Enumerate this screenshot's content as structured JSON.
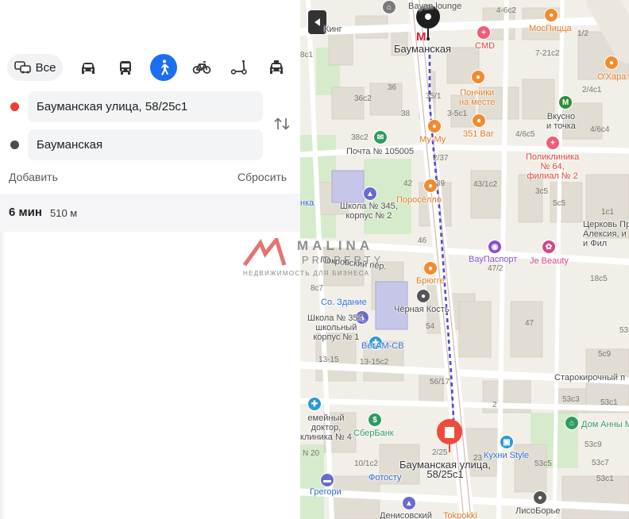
{
  "panel": {
    "modes": {
      "all_label": "Все",
      "items": [
        {
          "icon": "car-icon"
        },
        {
          "icon": "bus-icon"
        },
        {
          "icon": "pedestrian-icon",
          "active": true
        },
        {
          "icon": "bicycle-icon"
        },
        {
          "icon": "scooter-icon"
        },
        {
          "icon": "taxi-icon"
        }
      ]
    },
    "route": {
      "from_value": "Бауманская улица, 58/25с1",
      "to_value": "Бауманская",
      "from_dot_color": "#f33a2e",
      "to_dot_color": "#4d4d4d"
    },
    "add_label": "Добавить",
    "reset_label": "Сбросить",
    "result": {
      "time": "6 мин",
      "distance": "510 м"
    }
  },
  "watermark": {
    "line1": "MALINA",
    "line2": "PROPERTY",
    "line3": "НЕДВИЖИМОСТЬ ДЛЯ БИЗНЕСА"
  },
  "map": {
    "labels": {
      "bayan_lounge": "Bayan lounge",
      "king": "Кинг",
      "cmd": "CMD",
      "mospizza": "МосПицца",
      "station": "Бауманская",
      "okhara": "О'Хара",
      "ponchiki": "Пончики\nна месте",
      "vkusno": "Вкусно\nи точка",
      "bar351": "351 Bar",
      "mumu": "Му-Му",
      "pochta": "Почта № 105005",
      "poliklinika": "Поликлиника\n№ 64,\nфилиал № 2",
      "poroselo": "Поросёлло",
      "school345": "Школа № 345,\nкорпус № 2",
      "tserkov": "Церковь Пр\nАлексия, и\nи Фил",
      "vaupasport": "ВауПаспорт",
      "jebeauty": "Je Beauty",
      "pokrovsky": "Покровский пер.",
      "bryugge": "Брюгге",
      "chernaya": "Чёрная Кость",
      "sozdanie": "Со. Здание",
      "school354": "Школа № 354,\nшкольный\nкорпус № 1",
      "vetam": "ВетАМ-СВ",
      "starokirochny": "Старокирочный п",
      "semeyny": "емейный\nдоктор,\nклиника № 4",
      "sberbank": "СберБанк",
      "dom_anny": "Дом Анны М",
      "kukhni": "Кухни Style",
      "destination": "Бауманская улица,\n58/25с1",
      "fotostudio": "Фотосту",
      "gregori": "Грегори",
      "lisoborye": "ЛисоБорье",
      "denisovsky": "Денисовский",
      "tokpokki": "Tokpokki",
      "linka": "нка"
    },
    "numbers": [
      "4-6c2",
      "7-21c2",
      "1/2",
      "2/4c1",
      "8c1",
      "36",
      "36c2",
      "35/1",
      "3-5c1",
      "38",
      "4/6c5",
      "4/6c4",
      "38c2",
      "2/37",
      "43/1c2",
      "3c5",
      "5c5",
      "1c1",
      "42",
      "39",
      "46",
      "47/2",
      "8c7",
      "18c5",
      "54",
      "47",
      "53",
      "13-15",
      "13-15c2",
      "5c9",
      "56/17",
      "53c3",
      "53c1",
      "2",
      "53c9",
      "53c5",
      "2/25",
      "53c7",
      "10/1c2",
      "N 20",
      "23",
      "53c1"
    ],
    "colors": {
      "route": "#4f4ad6",
      "metro": "#d6203a",
      "building": "#e1dcd2",
      "park": "#cfe8c4",
      "road": "#ffffff"
    }
  }
}
